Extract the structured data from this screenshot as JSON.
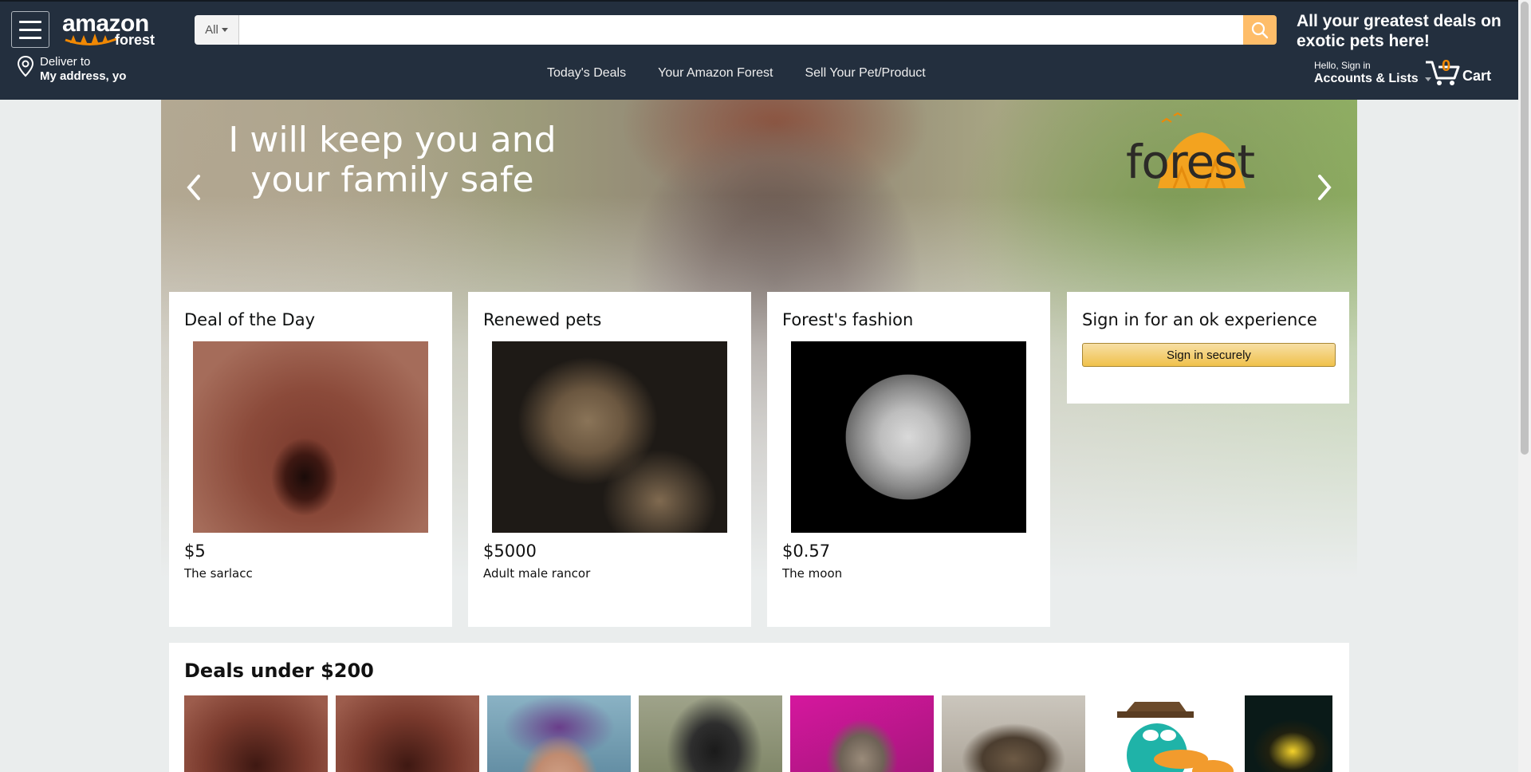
{
  "header": {
    "logo_top": "amazon",
    "logo_bottom": "forest",
    "search": {
      "category": "All",
      "placeholder": "",
      "value": ""
    },
    "promo": "All your greatest deals on exotic pets here!",
    "deliver": {
      "line1": "Deliver to",
      "line2": "My address, yo"
    },
    "nav": [
      "Today's Deals",
      "Your Amazon Forest",
      "Sell Your Pet/Product"
    ],
    "account": {
      "line1": "Hello, Sign in",
      "line2": "Accounts & Lists"
    },
    "cart": {
      "count": "0",
      "label": "Cart"
    },
    "accent_color": "#febd69",
    "bg_color": "#232f3e"
  },
  "hero": {
    "slogan": "I will keep you and your family safe",
    "brand": "forest"
  },
  "cards": [
    {
      "title": "Deal of the Day",
      "price": "$5",
      "desc": "The sarlacc",
      "image": "sarlacc-pit"
    },
    {
      "title": "Renewed pets",
      "price": "$5000",
      "desc": "Adult male rancor",
      "image": "rancor"
    },
    {
      "title": "Forest's fashion",
      "price": "$0.57",
      "desc": "The moon",
      "image": "moon"
    }
  ],
  "signin": {
    "title": "Sign in for an ok experience",
    "button": "Sign in securely"
  },
  "deals": {
    "title": "Deals under $200",
    "thumbs": [
      "sarlacc",
      "sarlacc",
      "selfie",
      "gorilla",
      "cat-food-box",
      "tortoise",
      "perry-the-platypus",
      "poison-dart-frog"
    ]
  }
}
